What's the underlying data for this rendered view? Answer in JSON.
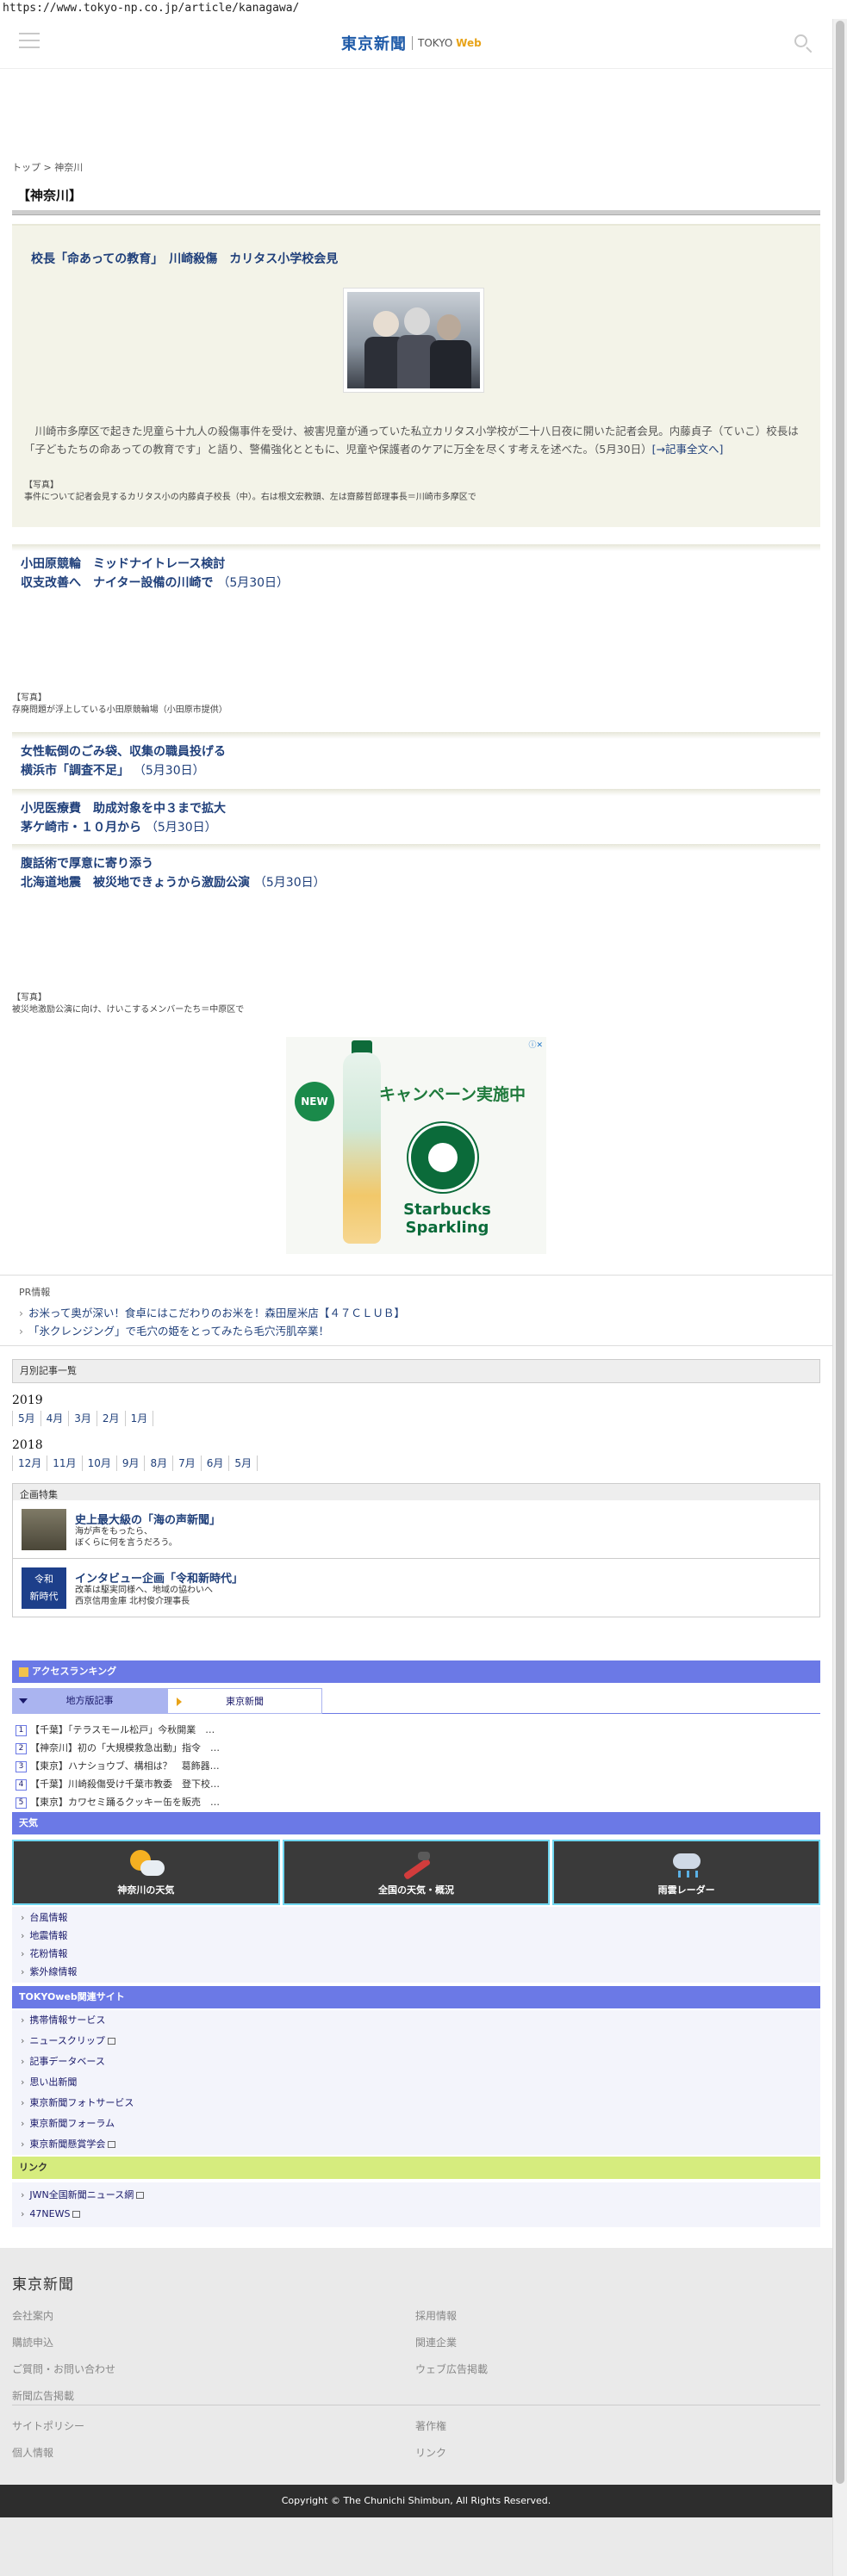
{
  "browser": {
    "url": "https://www.tokyo-np.co.jp/article/kanagawa/"
  },
  "header": {
    "logo_jp": "東京新聞",
    "logo_en_prefix": "TOKYO",
    "logo_en_suffix": "Web"
  },
  "breadcrumb": {
    "home": "トップ",
    "sep": ">",
    "current": "神奈川"
  },
  "section_title": "【神奈川】",
  "lead": {
    "headline": "校長「命あっての教育」　川崎殺傷　カリタス小学校会見",
    "summary": "川崎市多摩区で起きた児童ら十九人の殺傷事件を受け、被害児童が通っていた私立カリタス小学校が二十八日夜に開いた記者会見。内藤貞子（ていこ）校長は「子どもたちの命あっての教育です」と語り、警備強化とともに、児童や保護者のケアに万全を尽くす考えを述べた。（5月30日）",
    "more_link": "[→記事全文へ]",
    "caption_label": "【写真】",
    "caption": "事件について記者会見するカリタス小の内藤貞子校長（中）。右は根文宏教頭、左は齋藤哲郎理事長＝川崎市多摩区で"
  },
  "articles": [
    {
      "title_line1": "小田原競輪　ミッドナイトレース検討",
      "title_line2": "収支改善へ　ナイター設備の川崎で",
      "date": "（5月30日）",
      "caption_label": "【写真】",
      "caption": "存廃問題が浮上している小田原競輪場（小田原市提供）"
    },
    {
      "title_line1": "女性転倒のごみ袋、収集の職員投げる",
      "title_line2": "横浜市「調査不足」",
      "date": "（5月30日）"
    },
    {
      "title_line1": "小児医療費　助成対象を中３まで拡大",
      "title_line2": "茅ケ崎市・１０月から",
      "date": "（5月30日）"
    },
    {
      "title_line1": "腹話術で厚意に寄り添う",
      "title_line2": "北海道地震　被災地できょうから激励公演",
      "date": "（5月30日）",
      "caption_label": "【写真】",
      "caption": "被災地激励公演に向け、けいこするメンバーたち＝中原区で"
    }
  ],
  "ad": {
    "badge": "NEW",
    "headline": "キャンペーン実施中",
    "brand_line1": "Starbucks",
    "brand_line2": "Sparkling",
    "adchoice": "ⓘ✕"
  },
  "pr": {
    "label": "PR情報",
    "items": [
      "お米って奥が深い！食卓にはこだわりのお米を！森田屋米店【４７ＣＬＵＢ】",
      "「氷クレンジング」で毛穴の姫をとってみたら毛穴汚肌卒業！"
    ]
  },
  "monthly": {
    "heading": "月別記事一覧",
    "years": [
      {
        "year": "2019",
        "months": [
          "5月",
          "4月",
          "3月",
          "2月",
          "1月"
        ]
      },
      {
        "year": "2018",
        "months": [
          "12月",
          "11月",
          "10月",
          "9月",
          "8月",
          "7月",
          "6月",
          "5月"
        ]
      }
    ]
  },
  "features": {
    "heading": "企画特集",
    "items": [
      {
        "title": "史上最大級の「海の声新聞」",
        "sub_line1": "海が声をもったら、",
        "sub_line2": "ぼくらに何を言うだろう。"
      },
      {
        "title": "インタビュー企画「令和新時代」",
        "sub_line1": "改革は駆実同様へ、地域の協わいへ",
        "sub_line2": "西京信用金庫 北村俊介理事長",
        "icon_text_1": "令和",
        "icon_text_2": "新時代"
      }
    ]
  },
  "ranking": {
    "heading": "アクセスランキング",
    "tab_local": "地方版記事",
    "tab_tokyo": "東京新聞",
    "items": [
      "【千葉】「テラスモール松戸」今秋開業　…",
      "【神奈川】初の「大規模救急出動」指令　…",
      "【東京】ハナショウブ、構相は？　葛飾器…",
      "【千葉】川崎殺傷受け千葉市教委　登下校…",
      "【東京】カワセミ踊るクッキー缶を販売　…"
    ]
  },
  "weather": {
    "heading": "天気",
    "tiles": [
      "神奈川の天気",
      "全国の天気・概況",
      "雨雲レーダー"
    ],
    "links": [
      "台風情報",
      "地震情報",
      "花粉情報",
      "紫外線情報"
    ]
  },
  "related": {
    "heading": "TOKYOweb関連サイト",
    "links": [
      "携帯情報サービス",
      "ニュースクリップ",
      "記事データベース",
      "思い出新聞",
      "東京新聞フォトサービス",
      "東京新聞フォーラム",
      "東京新聞懸賞学会"
    ]
  },
  "links": {
    "heading": "リンク",
    "items": [
      "JWN全国新聞ニュース網",
      "47NEWS"
    ]
  },
  "footer": {
    "logo": "東京新聞",
    "col_left": [
      "会社案内",
      "購読申込",
      "ご質問・お問い合わせ",
      "新聞広告掲載"
    ],
    "col_right": [
      "採用情報",
      "関連企業",
      "ウェブ広告掲載"
    ],
    "col_left2": [
      "サイトポリシー",
      "個人情報"
    ],
    "col_right2": [
      "著作権",
      "リンク"
    ],
    "copyright": "Copyright © The Chunichi Shimbun, All Rights Reserved."
  }
}
